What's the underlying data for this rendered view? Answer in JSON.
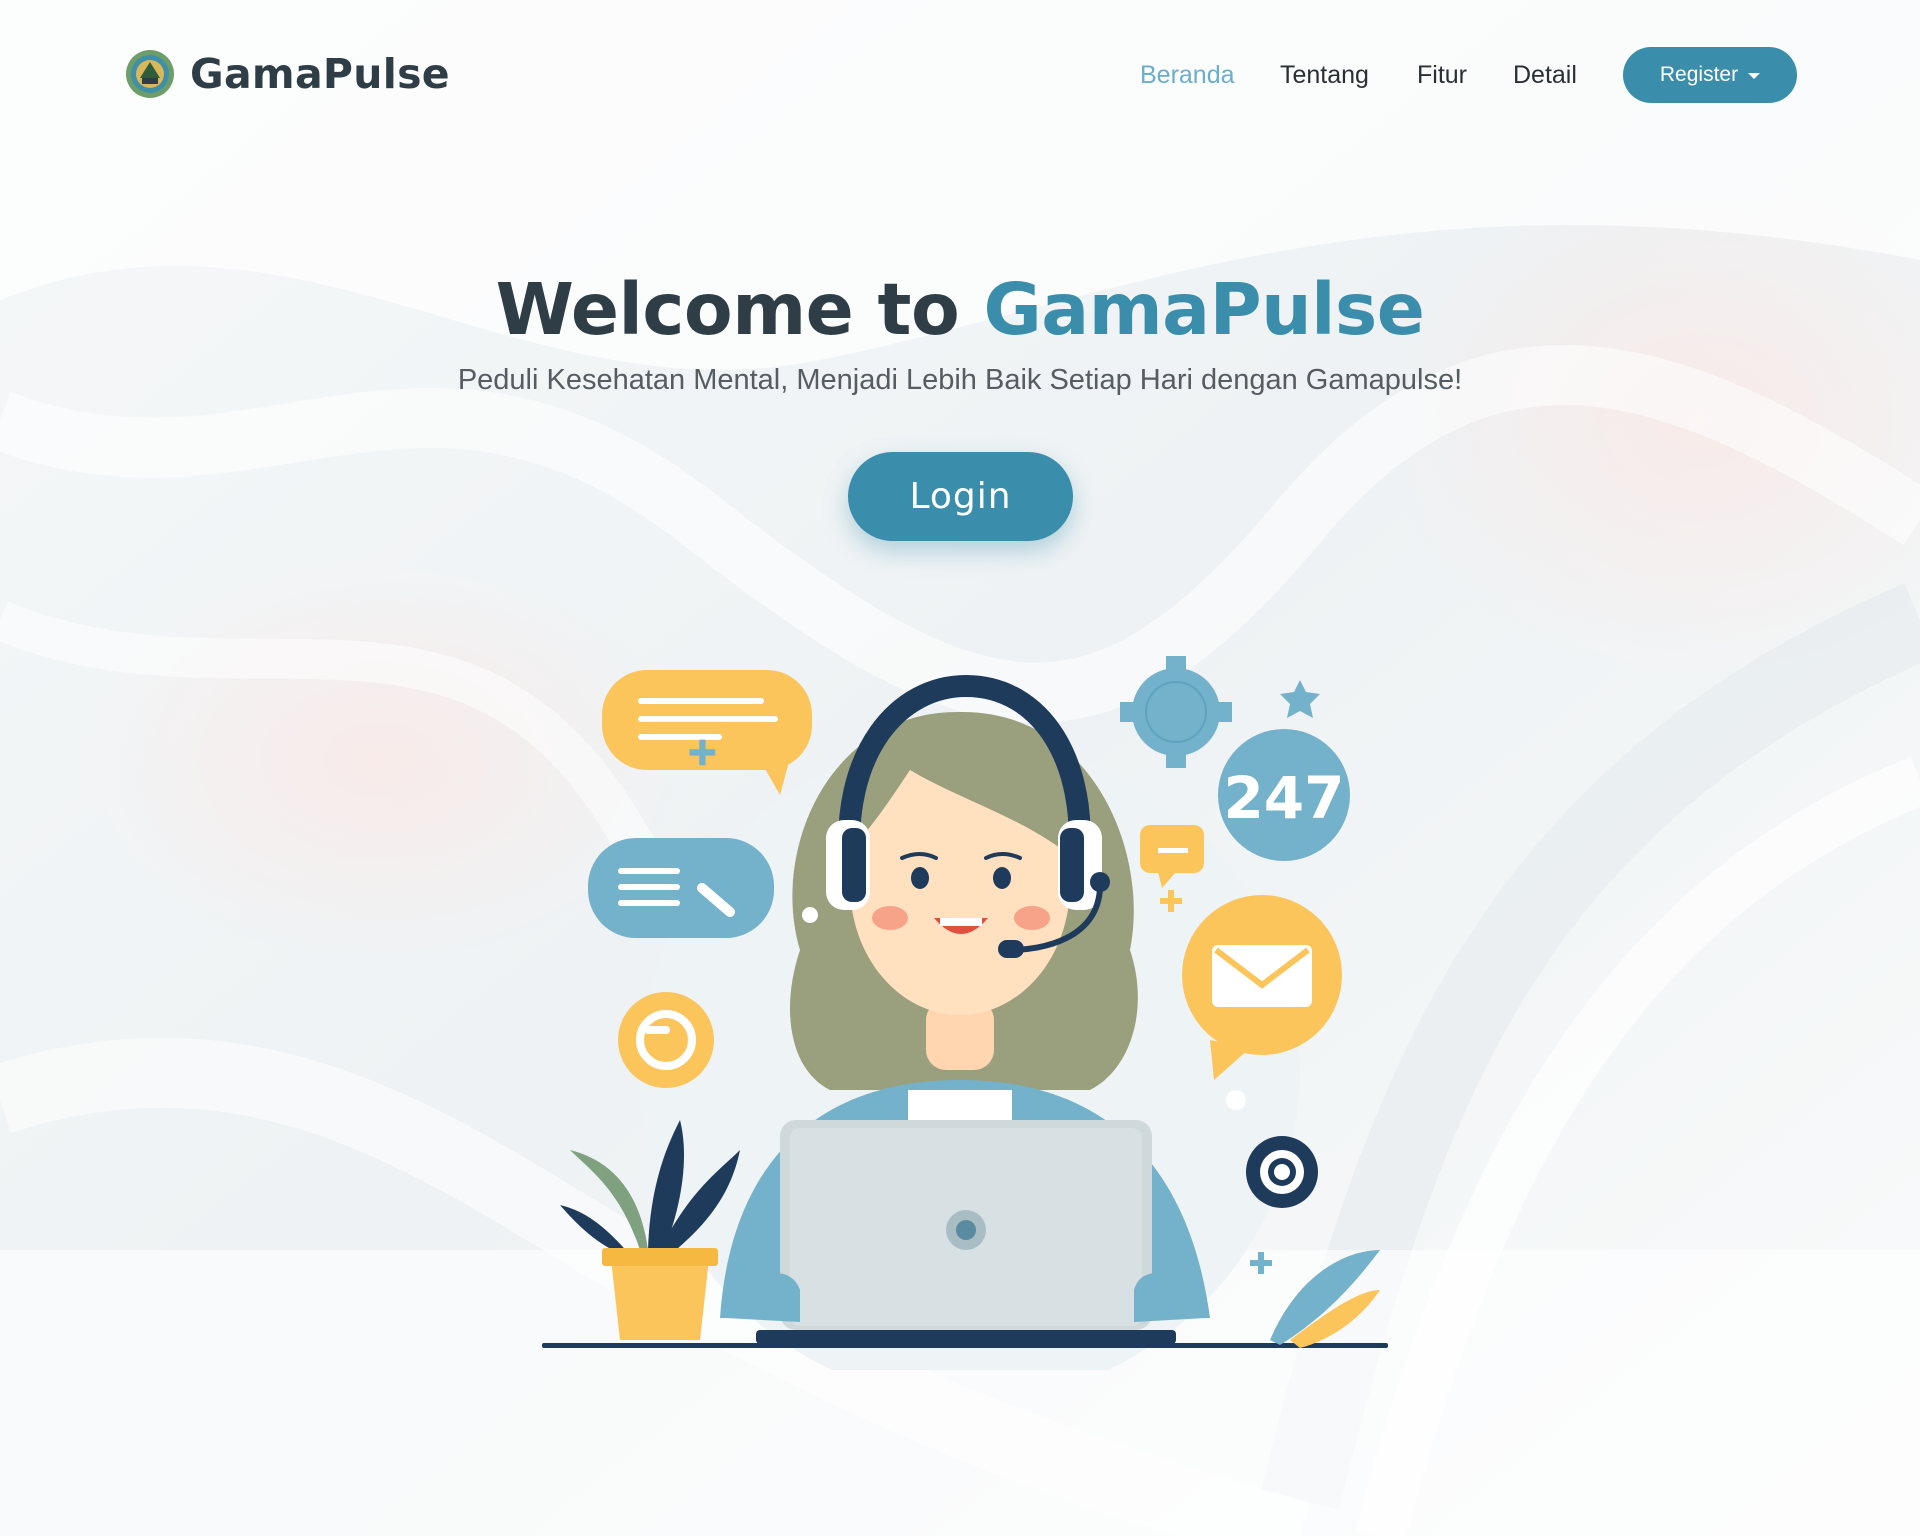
{
  "brand": {
    "name": "GamaPulse",
    "logo_icon": "university-seal-icon"
  },
  "nav": {
    "items": [
      {
        "label": "Beranda",
        "active": true
      },
      {
        "label": "Tentang",
        "active": false
      },
      {
        "label": "Fitur",
        "active": false
      },
      {
        "label": "Detail",
        "active": false
      }
    ],
    "register_label": "Register",
    "register_icon": "caret-down-icon"
  },
  "hero": {
    "title_prefix": "Welcome to",
    "title_accent": "GamaPulse",
    "subtitle": "Peduli Kesehatan Mental, Menjadi Lebih Baik Setiap Hari dengan Gamapulse!",
    "login_label": "Login"
  },
  "illustration": {
    "badge_text": "247",
    "icons": [
      "headset-agent-illustration",
      "chat-bubble-icon",
      "message-bubble-icon",
      "mail-icon",
      "gear-icon",
      "refresh-icon",
      "star-icon",
      "laptop-icon",
      "plant-icon"
    ]
  },
  "colors": {
    "primary": "#3a8eab",
    "nav_active": "#6aaecb",
    "heading": "#2f3e46",
    "subtitle": "#555d62",
    "yellow": "#fbc55c",
    "light_blue": "#74b2cc"
  }
}
